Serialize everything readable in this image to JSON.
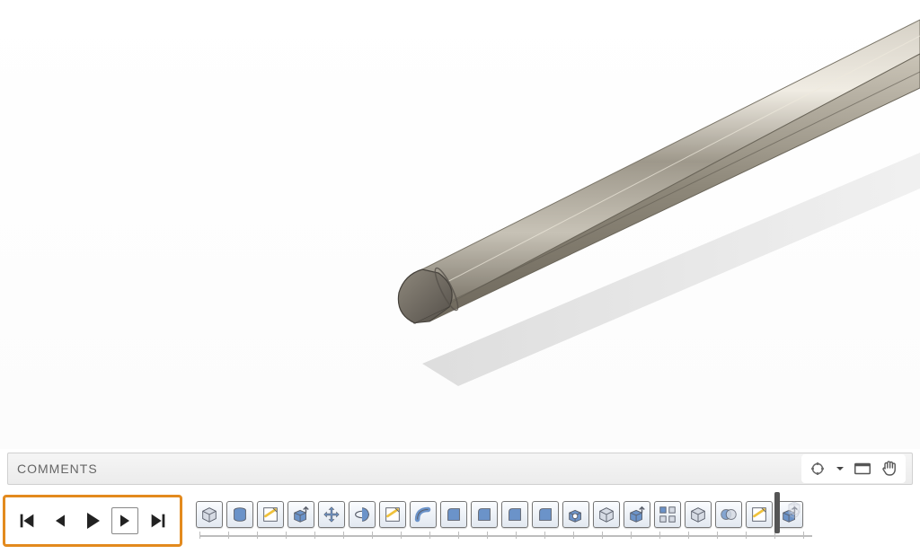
{
  "comments": {
    "title": "COMMENTS",
    "add_label": "+"
  },
  "view_controls": {
    "orbit": "orbit-icon",
    "dropdown": "caret-down-icon",
    "lookat": "look-at-icon",
    "pan": "pan-hand-icon"
  },
  "playback": {
    "go_start": "go-to-start",
    "step_back": "step-back",
    "play": "play",
    "step_forward": "step-forward",
    "go_end": "go-to-end"
  },
  "timeline": {
    "features": [
      {
        "name": "feature-new-component",
        "type": "component"
      },
      {
        "name": "feature-cylinder",
        "type": "cylinder"
      },
      {
        "name": "feature-sketch-1",
        "type": "sketch"
      },
      {
        "name": "feature-extrude-1",
        "type": "extrude"
      },
      {
        "name": "feature-move-1",
        "type": "move"
      },
      {
        "name": "feature-revolve",
        "type": "revolve"
      },
      {
        "name": "feature-sketch-2",
        "type": "sketch"
      },
      {
        "name": "feature-sweep",
        "type": "sweep"
      },
      {
        "name": "feature-fillet-1",
        "type": "fillet"
      },
      {
        "name": "feature-fillet-2",
        "type": "fillet"
      },
      {
        "name": "feature-fillet-3",
        "type": "fillet"
      },
      {
        "name": "feature-fillet-4",
        "type": "fillet"
      },
      {
        "name": "feature-shell",
        "type": "shell"
      },
      {
        "name": "feature-body-1",
        "type": "body"
      },
      {
        "name": "feature-extrude-2",
        "type": "extrude"
      },
      {
        "name": "feature-pattern",
        "type": "pattern"
      },
      {
        "name": "feature-body-2",
        "type": "body"
      },
      {
        "name": "feature-combine",
        "type": "combine"
      },
      {
        "name": "feature-sketch-3",
        "type": "sketch"
      },
      {
        "name": "feature-extrude-3",
        "type": "extrude"
      }
    ],
    "ghost_after_end": 1
  },
  "colors": {
    "highlight_box": "#E38A1E",
    "icon_blue": "#6B93C9",
    "icon_edit": "#F0C23B"
  }
}
